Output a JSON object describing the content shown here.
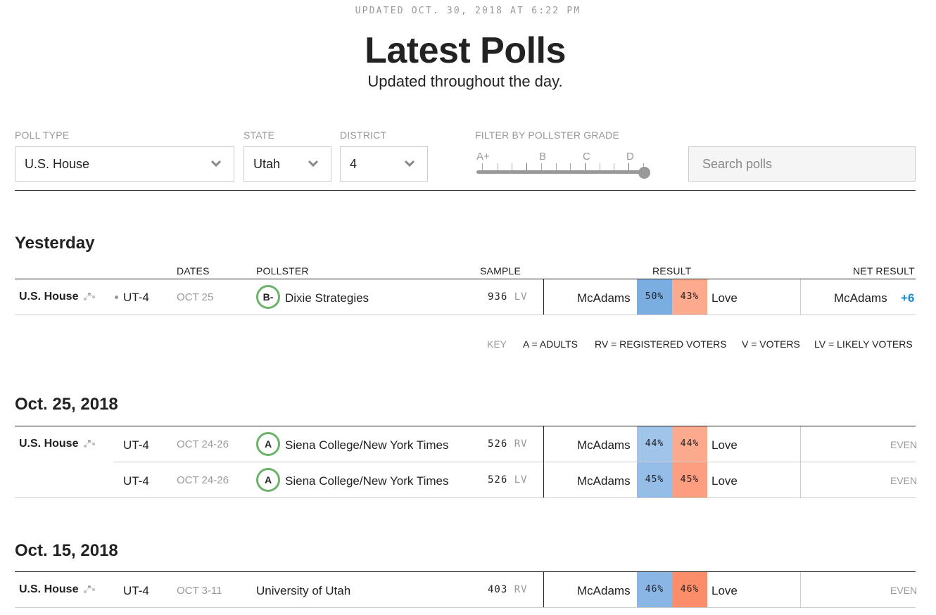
{
  "header": {
    "updated": "UPDATED OCT. 30, 2018 AT 6:22 PM",
    "title": "Latest Polls",
    "subtitle": "Updated throughout the day."
  },
  "filters": {
    "poll_type": {
      "label": "POLL TYPE",
      "value": "U.S. House"
    },
    "state": {
      "label": "STATE",
      "value": "Utah"
    },
    "district": {
      "label": "DISTRICT",
      "value": "4"
    },
    "grade": {
      "label": "FILTER BY POLLSTER GRADE",
      "tick_labels": [
        "A+",
        "B",
        "C",
        "D"
      ],
      "selected_max_grade": "D-",
      "value_fraction": 1.0
    },
    "search": {
      "placeholder": "Search polls",
      "value": ""
    }
  },
  "columns": {
    "dates": "DATES",
    "pollster": "POLLSTER",
    "sample": "SAMPLE",
    "result": "RESULT",
    "net_result": "NET RESULT"
  },
  "key": {
    "label": "KEY",
    "items": [
      "A = ADULTS",
      "RV = REGISTERED VOTERS",
      "V = VOTERS",
      "LV = LIKELY VOTERS"
    ]
  },
  "colors": {
    "dem_strong": "#7aaee0",
    "dem_light": "#a0c4ea",
    "rep_strong": "#fc8d6a",
    "rep_light": "#fcaa8e",
    "grade_ring": "#6bb36b",
    "net_blue": "#1a8ad0"
  },
  "sections": [
    {
      "title": "Yesterday",
      "rows": [
        {
          "type": "U.S. House",
          "district": "UT-4",
          "dates": "OCT 25",
          "grade": "B-",
          "pollster": "Dixie Strategies",
          "sample": "936",
          "population": "LV",
          "cand1": "McAdams",
          "pct1": "50%",
          "pct2": "43%",
          "cand2": "Love",
          "net_name": "McAdams",
          "net_value": "+6"
        }
      ]
    },
    {
      "title": "Oct. 25, 2018",
      "rows": [
        {
          "type": "U.S. House",
          "district": "UT-4",
          "dates": "OCT 24-26",
          "grade": "A",
          "pollster": "Siena College/New York Times",
          "sample": "526",
          "population": "RV",
          "cand1": "McAdams",
          "pct1": "44%",
          "pct2": "44%",
          "cand2": "Love",
          "net_value": "EVEN"
        },
        {
          "district": "UT-4",
          "dates": "OCT 24-26",
          "grade": "A",
          "pollster": "Siena College/New York Times",
          "sample": "526",
          "population": "LV",
          "cand1": "McAdams",
          "pct1": "45%",
          "pct2": "45%",
          "cand2": "Love",
          "net_value": "EVEN"
        }
      ]
    },
    {
      "title": "Oct. 15, 2018",
      "rows": [
        {
          "type": "U.S. House",
          "district": "UT-4",
          "dates": "OCT 3-11",
          "pollster": "University of Utah",
          "sample": "403",
          "population": "RV",
          "cand1": "McAdams",
          "pct1": "46%",
          "pct2": "46%",
          "cand2": "Love",
          "net_value": "EVEN"
        }
      ]
    }
  ]
}
